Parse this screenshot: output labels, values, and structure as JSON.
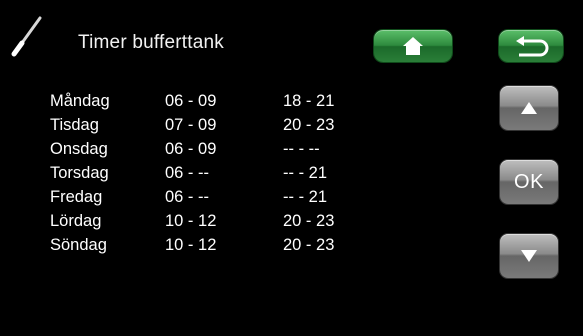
{
  "header": {
    "title": "Timer bufferttank",
    "icon": "screwdriver-icon",
    "home_icon": "home-icon",
    "back_icon": "back-arrow-icon",
    "accent_color": "#2d8a3d"
  },
  "schedule": [
    {
      "day": "Måndag",
      "period1": "06 - 09",
      "period2": "18 - 21"
    },
    {
      "day": "Tisdag",
      "period1": "07 - 09",
      "period2": "20 - 23"
    },
    {
      "day": "Onsdag",
      "period1": "06 - 09",
      "period2": "-- - --"
    },
    {
      "day": "Torsdag",
      "period1": "06 - --",
      "period2": "-- - 21"
    },
    {
      "day": "Fredag",
      "period1": "06 - --",
      "period2": "-- - 21"
    },
    {
      "day": "Lördag",
      "period1": "10 - 12",
      "period2": "20 - 23"
    },
    {
      "day": "Söndag",
      "period1": "10 - 12",
      "period2": "20 - 23"
    }
  ],
  "side_buttons": {
    "ok_label": "OK",
    "up_icon": "arrow-up-icon",
    "down_icon": "arrow-down-icon"
  }
}
